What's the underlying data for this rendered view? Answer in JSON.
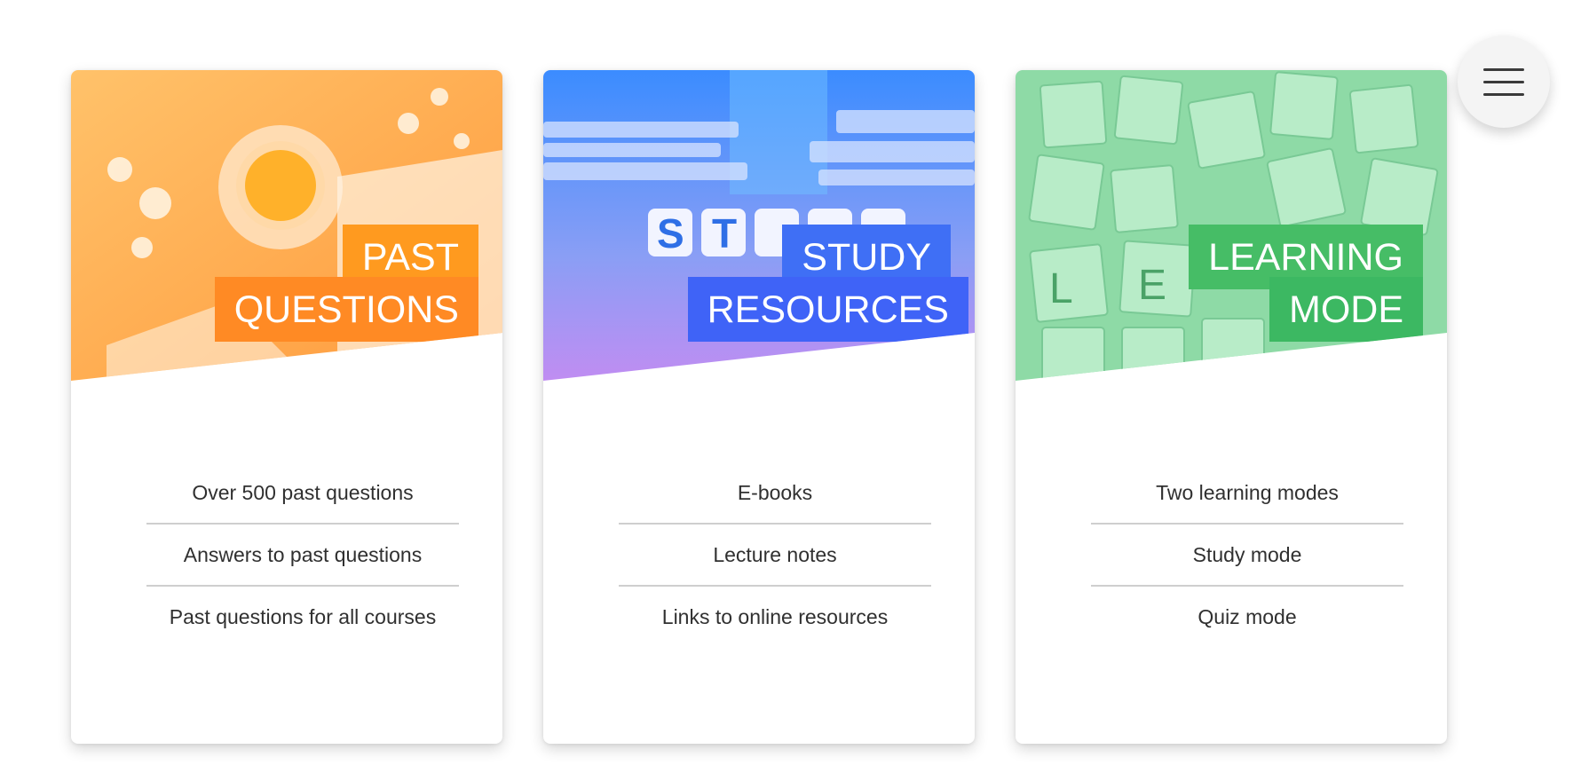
{
  "cards": [
    {
      "title_lines": [
        "PAST",
        "QUESTIONS"
      ],
      "image_icon": "tea-flowers-book-image",
      "gradient": [
        "#ffb347",
        "#ff7a2e"
      ],
      "label_color": "#ff8a1f",
      "features": [
        "Over 500 past questions",
        "Answers to past questions",
        "Past questions for all courses"
      ]
    },
    {
      "title_lines": [
        "STUDY",
        "RESOURCES"
      ],
      "image_icon": "study-blocks-books-image",
      "gradient": [
        "#3a8dff",
        "#b98cf5"
      ],
      "label_color": "#3d6cff",
      "features": [
        "E-books",
        "Lecture notes",
        "Links to online resources"
      ]
    },
    {
      "title_lines": [
        "LEARNING",
        "MODE"
      ],
      "image_icon": "scrabble-tiles-image",
      "gradient": [
        "#8fe0a8",
        "#4cc47a"
      ],
      "label_color": "#3dba63",
      "features": [
        "Two learning modes",
        "Study mode",
        "Quiz mode"
      ]
    }
  ],
  "menu": {
    "icon": "hamburger-menu-icon"
  }
}
